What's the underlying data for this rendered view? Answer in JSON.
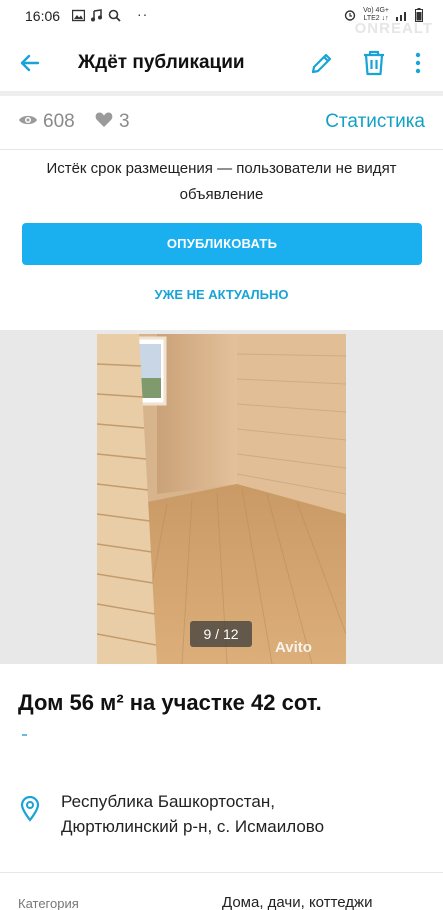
{
  "status_bar": {
    "time": "16:06",
    "dots": "··",
    "network_top": "Vo) 4G+",
    "network_bottom": "LTE2 ↓↑",
    "watermark": "ONREALT"
  },
  "app_bar": {
    "title": "Ждёт публикации"
  },
  "stats": {
    "views": "608",
    "likes": "3",
    "link_label": "Статистика"
  },
  "notice": {
    "text": "Истёк срок размещения — пользователи не видят объявление"
  },
  "actions": {
    "publish_label": "ОПУБЛИКОВАТЬ",
    "not_actual_label": "УЖЕ НЕ АКТУАЛЬНО"
  },
  "gallery": {
    "counter": "9 / 12",
    "watermark": "Avito"
  },
  "listing": {
    "title": "Дом 56 м² на участке 42 сот.",
    "address_line1": "Республика Башкортостан,",
    "address_line2": "Дюртюлинский р-н, с. Исмаилово"
  },
  "details": {
    "category_label": "Категория",
    "category_value": "Дома, дачи, коттеджи"
  },
  "colors": {
    "accent": "#1ab0f0",
    "link": "#12a1c4"
  }
}
